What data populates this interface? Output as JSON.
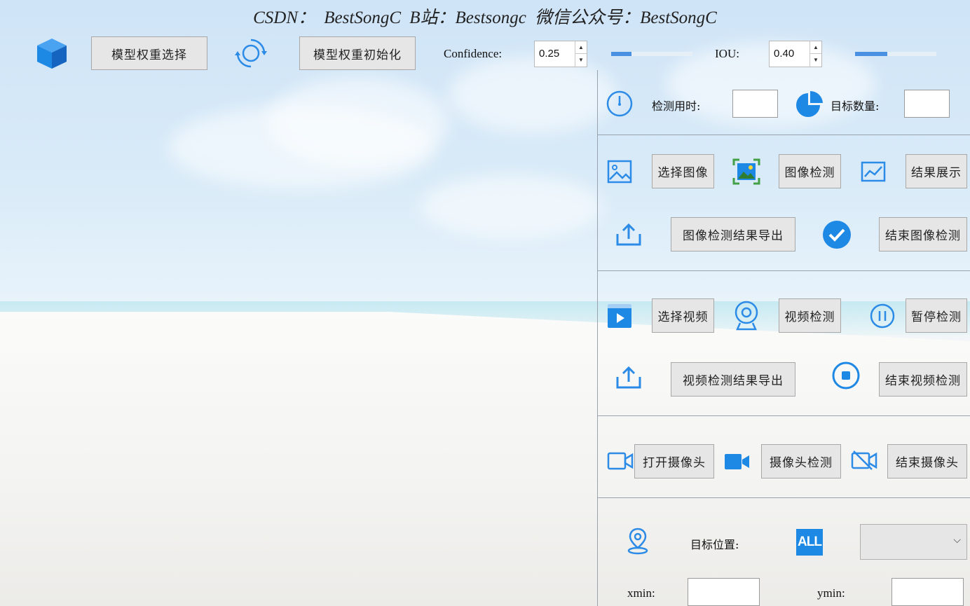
{
  "header": {
    "title": "CSDN：  BestSongC    B站：Bestsongc    微信公众号：BestSongC"
  },
  "toolbar": {
    "model_select_label": "模型权重选择",
    "model_init_label": "模型权重初始化",
    "confidence_label": "Confidence:",
    "confidence_value": "0.25",
    "confidence_slider_fraction": 0.25,
    "iou_label": "IOU:",
    "iou_value": "0.40",
    "iou_slider_fraction": 0.4
  },
  "stats": {
    "time_label": "检测用时:",
    "time_value": "",
    "count_label": "目标数量:",
    "count_value": ""
  },
  "image_section": {
    "select_label": "选择图像",
    "detect_label": "图像检测",
    "show_label": "结果展示",
    "export_label": "图像检测结果导出",
    "stop_label": "结束图像检测"
  },
  "video_section": {
    "select_label": "选择视频",
    "detect_label": "视频检测",
    "pause_label": "暂停检测",
    "export_label": "视频检测结果导出",
    "stop_label": "结束视频检测"
  },
  "camera_section": {
    "open_label": "打开摄像头",
    "detect_label": "摄像头检测",
    "stop_label": "结束摄像头"
  },
  "location_section": {
    "position_label": "目标位置:",
    "all_icon_text": "ALL",
    "select_value": "",
    "xmin_label": "xmin:",
    "xmin_value": "",
    "ymin_label": "ymin:",
    "ymin_value": ""
  },
  "colors": {
    "accent": "#1e88e5",
    "button_bg": "#e6e6e6"
  }
}
